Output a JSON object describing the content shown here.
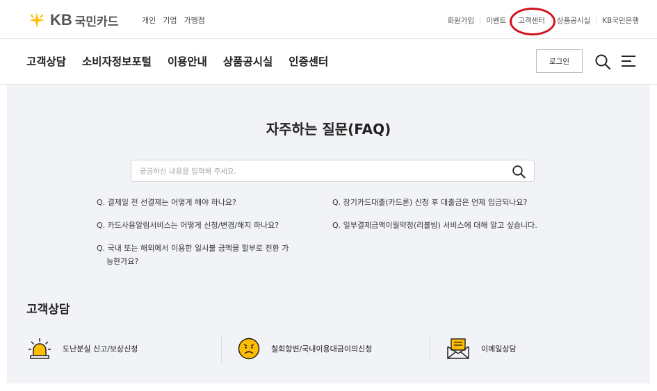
{
  "header": {
    "logo_text_kb": "KB",
    "logo_text_name": "국민카드",
    "segments": [
      "개인",
      "기업",
      "가맹점"
    ],
    "util_links": [
      "회원가입",
      "이벤트",
      "고객센터",
      "상품공시실",
      "KB국민은행"
    ],
    "highlighted_util": "고객센터"
  },
  "nav": {
    "items": [
      "고객상담",
      "소비자정보포털",
      "이용안내",
      "상품공시실",
      "인증센터"
    ],
    "login_label": "로그인"
  },
  "faq": {
    "title": "자주하는 질문(FAQ)",
    "search_placeholder": "궁금하신 내용을 입력해 주세요.",
    "left_questions": [
      "Q. 결제일 전 선결제는 어떻게 해야 하나요?",
      "Q. 카드사용알림서비스는 어떻게 신청/변경/해지 하나요?",
      "Q. 국내 또는 해외에서 이용한 일시불 금액을 할부로 전환 가능한가요?"
    ],
    "right_questions": [
      "Q. 장기카드대출(카드론) 신청 후 대출금은 언제 입금되나요?",
      "Q. 일부결제금액이월약정(리볼빙) 서비스에 대해 알고 싶습니다."
    ]
  },
  "consult": {
    "title": "고객상담",
    "items": [
      {
        "label": "도난분실 신고/보상신청",
        "icon": "siren-icon"
      },
      {
        "label": "철회항변/국내이용대금이의신청",
        "icon": "sad-face-icon"
      },
      {
        "label": "이메일상담",
        "icon": "email-icon"
      }
    ]
  },
  "colors": {
    "brand_yellow": "#ffbc00",
    "highlight_red": "#d0121b",
    "content_bg": "#f1f3f6"
  }
}
